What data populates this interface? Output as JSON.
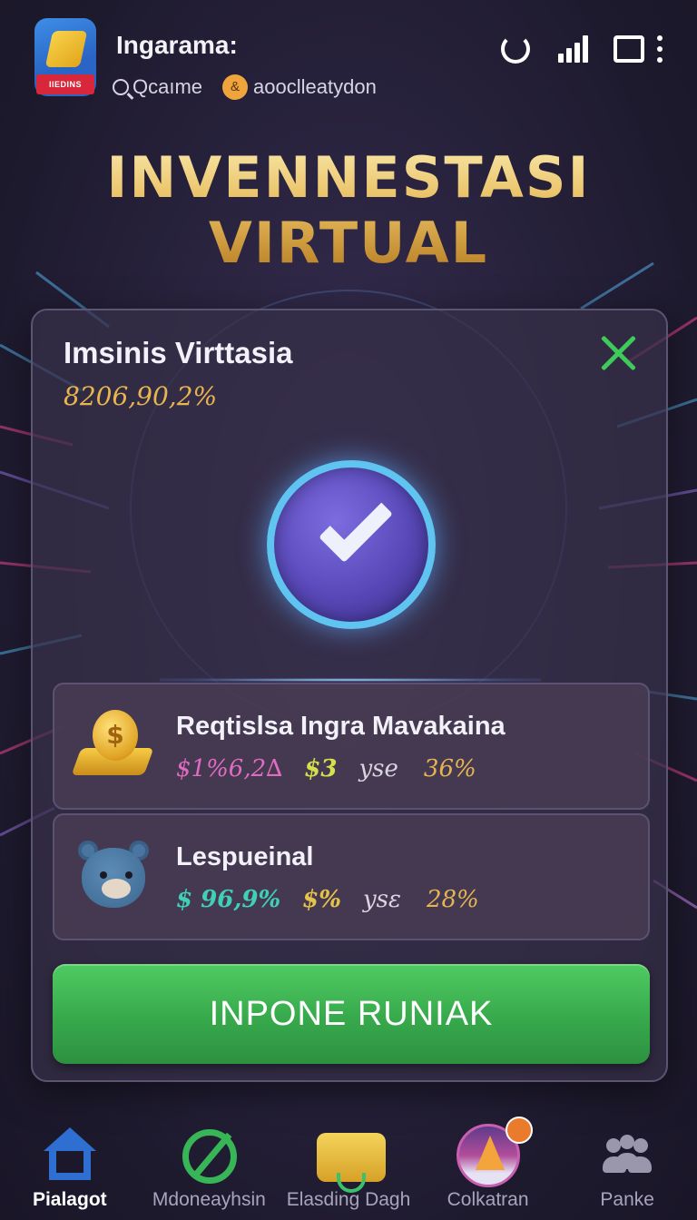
{
  "header": {
    "app_icon_label": "IIEDINS",
    "app_title": "Ingarama:",
    "sub_items": [
      {
        "icon": "search-icon",
        "label": "Qcaıme"
      },
      {
        "icon": "badge-icon",
        "label": "aooclleatydon"
      }
    ],
    "status_icons": [
      "refresh-icon",
      "signal-icon",
      "window-icon",
      "more-icon"
    ]
  },
  "hero": {
    "line1": "INVENNESTASI",
    "line2": "VIRTUAL"
  },
  "panel": {
    "title": "Imsinis Virttasia",
    "value": "8206,90,2%",
    "close_icon": "close-icon",
    "status_icon": "checkmark-icon"
  },
  "cards": [
    {
      "icon": "gold-coin-icon",
      "title": "Reqtislsa Ingra Mavakaina",
      "stat_1": "$1%6,2∆",
      "stat_2": "$3",
      "stat_3_label": "yse",
      "stat_3_value": "36%"
    },
    {
      "icon": "bear-icon",
      "title": "Lespueinal",
      "stat_1": "$ 96,9%",
      "stat_2": "$%",
      "stat_3_label": "ysε",
      "stat_3_value": "28%"
    }
  ],
  "cta": {
    "label": "INPONE RUNIAK"
  },
  "bottom_nav": [
    {
      "icon": "home-icon",
      "label": "Pialagot",
      "active": true
    },
    {
      "icon": "money-icon",
      "label": "Mdoneayhsin",
      "active": false
    },
    {
      "icon": "gold-bar-icon",
      "label": "Elasding Dagh",
      "active": false
    },
    {
      "icon": "collection-icon",
      "label": "Colkatran",
      "active": false
    },
    {
      "icon": "people-icon",
      "label": "Panke",
      "active": false
    }
  ],
  "colors": {
    "gold_text": "#e8be60",
    "accent_green": "#37a94c",
    "nav_active_blue": "#2f6fd1",
    "panel_bg": "#362f48"
  }
}
